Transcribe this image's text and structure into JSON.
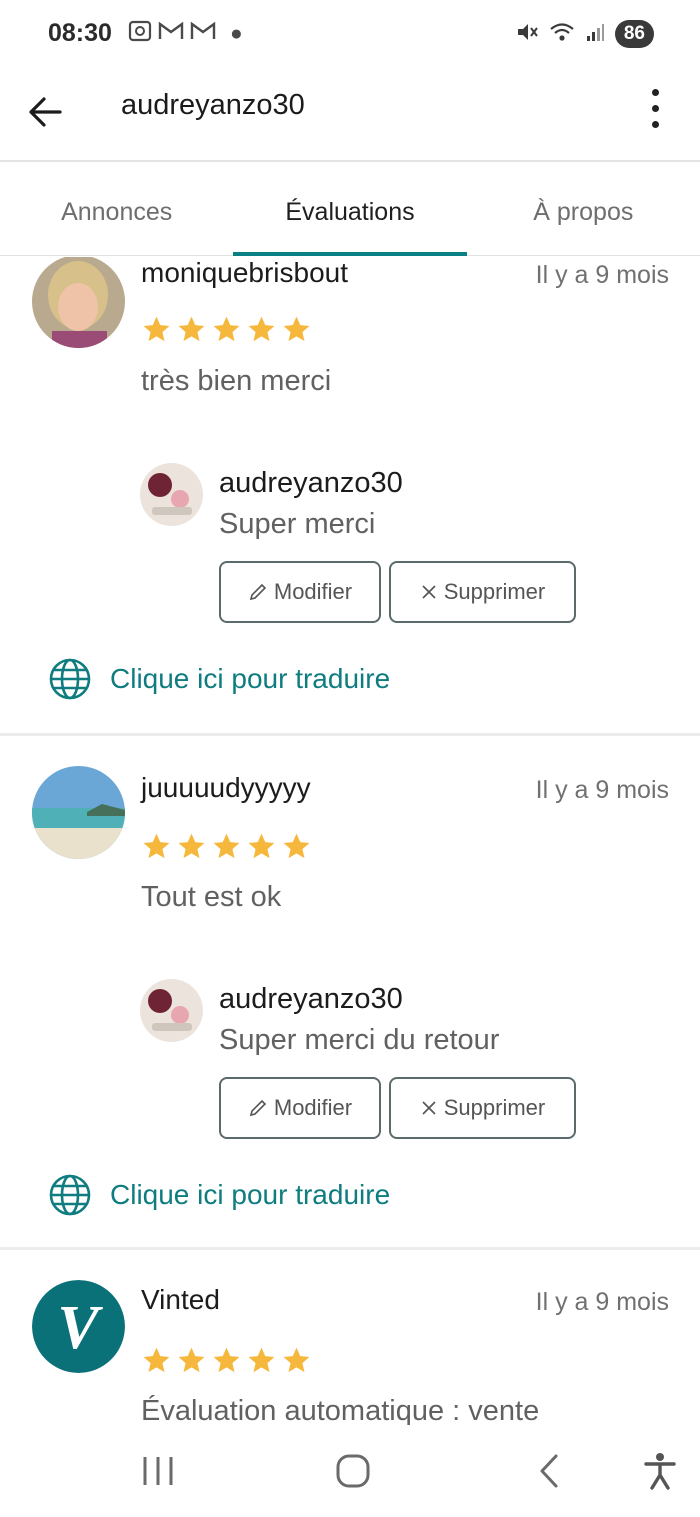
{
  "status_bar": {
    "time": "08:30",
    "battery": "86",
    "icons": [
      "screenshot-icon",
      "gmail-icon",
      "gmail-icon",
      "notification-dot-icon",
      "mute-icon",
      "wifi-icon",
      "signal-icon",
      "battery-icon"
    ]
  },
  "header": {
    "title": "audreyanzo30",
    "back_icon": "arrow-left-icon",
    "menu_icon": "more-vert-icon"
  },
  "tabs": [
    {
      "label": "Annonces",
      "active": false
    },
    {
      "label": "Évaluations",
      "active": true
    },
    {
      "label": "À propos",
      "active": false
    }
  ],
  "reviews": [
    {
      "author": "moniquebrisbout",
      "time": "Il y a 9 mois",
      "rating": 5,
      "text": "très bien merci",
      "reply": {
        "author": "audreyanzo30",
        "text": "Super merci",
        "edit_label": "Modifier",
        "delete_label": "Supprimer"
      },
      "translate_label": "Clique ici pour traduire"
    },
    {
      "author": "juuuuudyyyyy",
      "time": "Il y a 9 mois",
      "rating": 5,
      "text": "Tout est ok",
      "reply": {
        "author": "audreyanzo30",
        "text": "Super merci du retour",
        "edit_label": "Modifier",
        "delete_label": "Supprimer"
      },
      "translate_label": "Clique ici pour traduire"
    },
    {
      "author": "Vinted",
      "time": "Il y a 9 mois",
      "rating": 5,
      "text": "Évaluation automatique : vente",
      "logo_letter": "V"
    }
  ],
  "colors": {
    "accent": "#0a7f84",
    "star": "#f6b83c",
    "vinted_logo": "#0b7179"
  },
  "nav_bar": {
    "icons": [
      "recents-icon",
      "home-icon",
      "back-icon",
      "accessibility-icon"
    ]
  }
}
